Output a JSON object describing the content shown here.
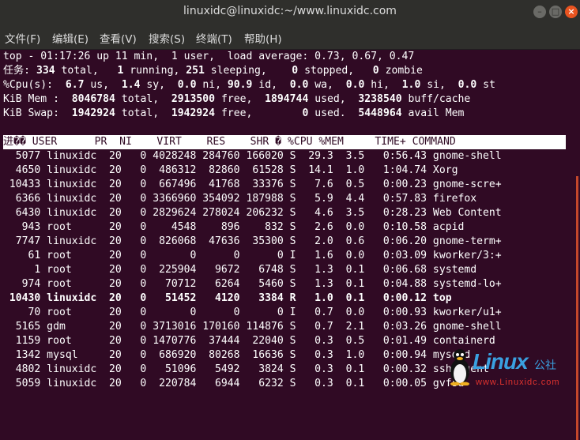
{
  "window": {
    "title": "linuxidc@linuxidc:~/www.linuxidc.com"
  },
  "menu": [
    "文件(F)",
    "编辑(E)",
    "查看(V)",
    "搜索(S)",
    "终端(T)",
    "帮助(H)"
  ],
  "summary": {
    "top_line": "top - 01:17:26 up 11 min,  1 user,  load average: 0.73, 0.67, 0.47",
    "tasks": {
      "label": "任务:",
      "total": "334",
      "total_label": "total,",
      "running": "1",
      "running_label": "running,",
      "sleeping": "251",
      "sleeping_label": "sleeping,",
      "stopped": "0",
      "stopped_label": "stopped,",
      "zombie": "0",
      "zombie_label": "zombie"
    },
    "cpu": {
      "label": "%Cpu(s):",
      "us": "6.7",
      "sy": "1.4",
      "ni": "0.0",
      "id": "90.9",
      "wa": "0.0",
      "hi": "0.0",
      "si": "1.0",
      "st": "0.0"
    },
    "mem": {
      "label": "KiB Mem :",
      "total": "8046784",
      "free": "2913500",
      "used": "1894744",
      "buff_cache": "3238540"
    },
    "swap": {
      "label": "KiB Swap:",
      "total": "1942924",
      "free": "1942924",
      "used": "0",
      "avail_mem": "5448964"
    }
  },
  "table": {
    "header": "进�� USER      PR  NI    VIRT    RES    SHR � %CPU %MEM     TIME+ COMMAND",
    "rows": [
      "  5077 linuxidc  20   0 4028248 284760 166020 S  29.3  3.5   0:56.43 gnome-shell",
      "  4650 linuxidc  20   0  486312  82860  61528 S  14.1  1.0   1:04.74 Xorg",
      " 10433 linuxidc  20   0  667496  41768  33376 S   7.6  0.5   0:00.23 gnome-scre+",
      "  6366 linuxidc  20   0 3366960 354092 187988 S   5.9  4.4   0:57.83 firefox",
      "  6430 linuxidc  20   0 2829624 278024 206232 S   4.6  3.5   0:28.23 Web Content",
      "   943 root      20   0    4548    896    832 S   2.6  0.0   0:10.58 acpid",
      "  7747 linuxidc  20   0  826068  47636  35300 S   2.0  0.6   0:06.20 gnome-term+",
      "    61 root      20   0       0      0      0 I   1.6  0.0   0:03.09 kworker/3:+",
      "     1 root      20   0  225904   9672   6748 S   1.3  0.1   0:06.68 systemd",
      "   974 root      20   0   70712   6264   5460 S   1.3  0.1   0:04.88 systemd-lo+",
      " 10430 linuxidc  20   0   51452   4120   3384 R   1.0  0.1   0:00.12 top",
      "    70 root      20   0       0      0      0 I   0.7  0.0   0:00.93 kworker/u1+",
      "  5165 gdm       20   0 3713016 170160 114876 S   0.7  2.1   0:03.26 gnome-shell",
      "  1159 root      20   0 1470776  37444  22040 S   0.3  0.5   0:01.49 containerd",
      "  1342 mysql     20   0  686920  80268  16636 S   0.3  1.0   0:00.94 mysqld",
      "  4802 linuxidc  20   0   51096   5492   3824 S   0.3  0.1   0:00.32 ssh-agent",
      "  5059 linuxidc  20   0  220784   6944   6232 S   0.3  0.1   0:00.05 gvfsd"
    ],
    "bold_row_index": 10
  },
  "watermark": {
    "brand": "Linux",
    "cn": "公社",
    "url": "www.Linuxidc.com"
  }
}
